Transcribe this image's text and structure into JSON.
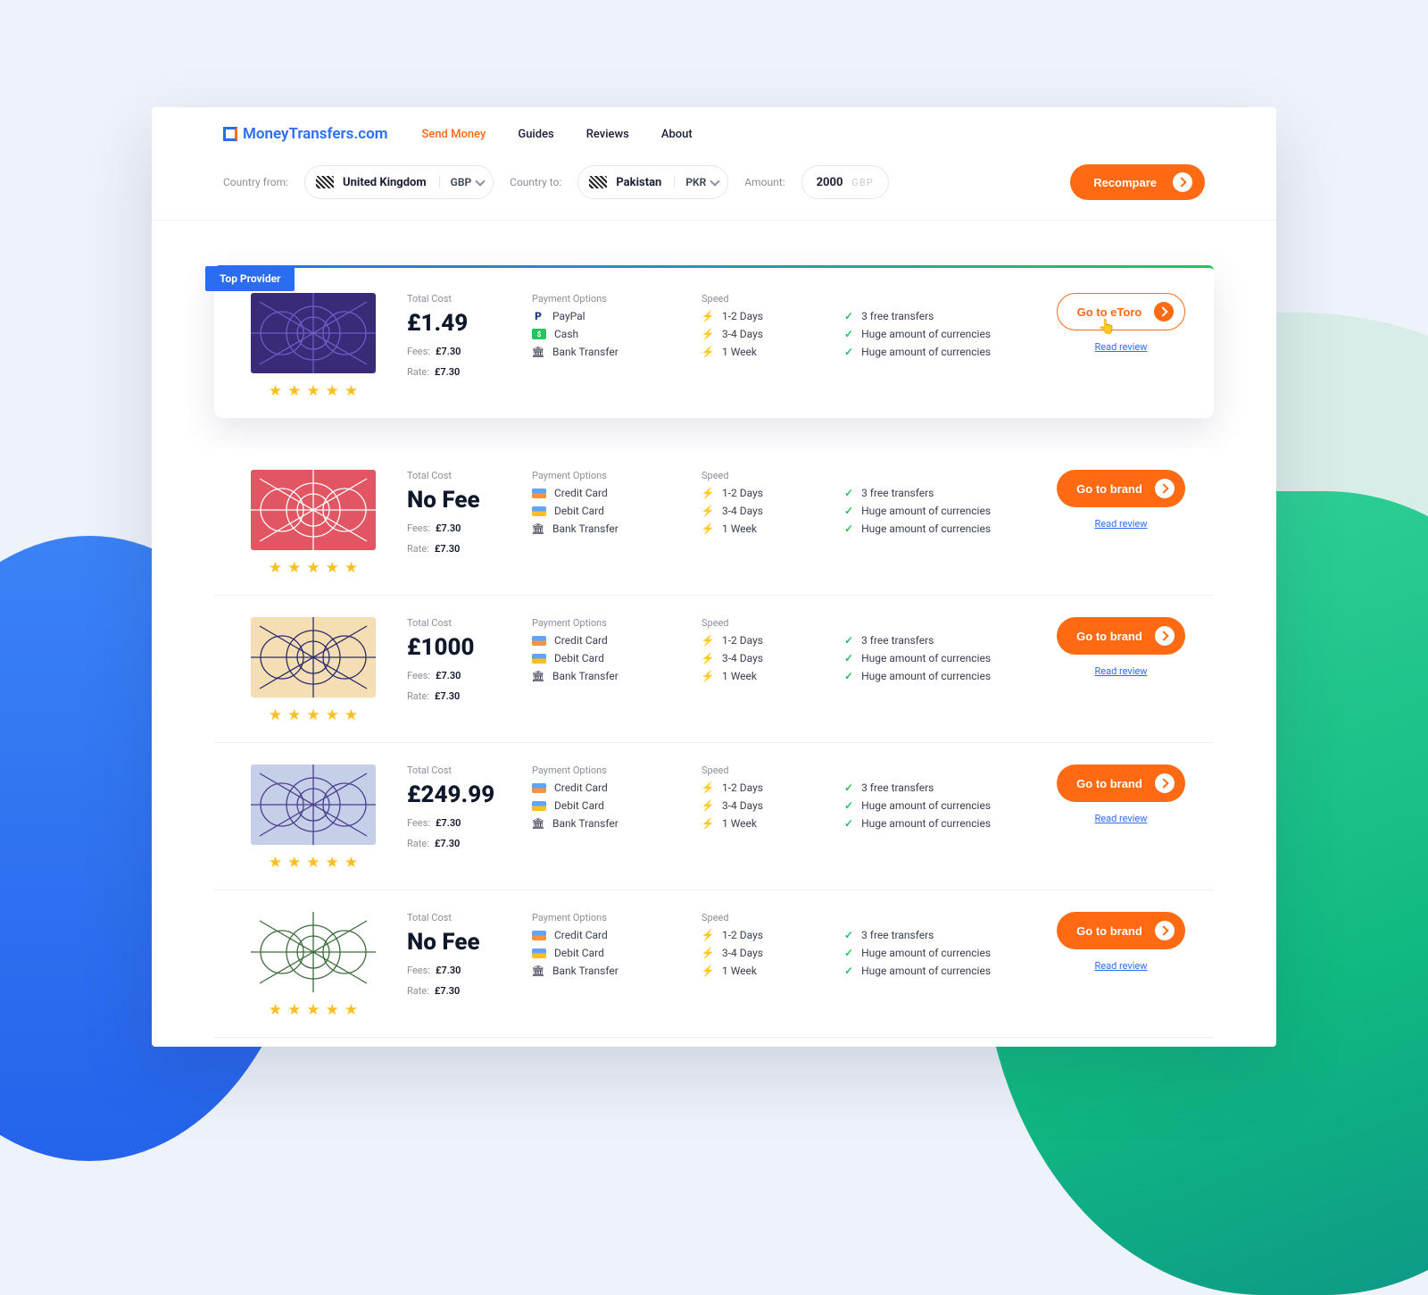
{
  "brand": "MoneyTransfers.com",
  "nav": {
    "items": [
      "Send Money",
      "Guides",
      "Reviews",
      "About"
    ],
    "active": "Send Money"
  },
  "filter": {
    "from_label": "Country from:",
    "from_country": "United Kingdom",
    "from_currency": "GBP",
    "to_label": "Country to:",
    "to_country": "Pakistan",
    "to_currency": "PKR",
    "amount_label": "Amount:",
    "amount_value": "2000",
    "amount_unit": "GBP",
    "button": "Recompare"
  },
  "labels": {
    "total_cost": "Total Cost",
    "payment_options": "Payment Options",
    "speed": "Speed",
    "fees": "Fees:",
    "rate": "Rate:",
    "read_review": "Read review",
    "top_badge": "Top Provider"
  },
  "speed_rows": [
    "1-2 Days",
    "3-4 Days",
    "1 Week"
  ],
  "benefit_rows": [
    "3 free transfers",
    "Huge amount of currencies",
    "Huge amount of currencies"
  ],
  "providers": [
    {
      "featured": true,
      "cost": "£1.49",
      "fees": "£7.30",
      "rate": "£7.30",
      "payments": [
        [
          "paypal",
          "PayPal"
        ],
        [
          "cash",
          "Cash"
        ],
        [
          "bank",
          "Bank Transfer"
        ]
      ],
      "cta": "Go to eToro",
      "thumb": {
        "bg": "#3b2a78",
        "lines": "#6d5ec7"
      }
    },
    {
      "featured": false,
      "cost": "No Fee",
      "fees": "£7.30",
      "rate": "£7.30",
      "payments": [
        [
          "cc",
          "Credit Card"
        ],
        [
          "dc",
          "Debit Card"
        ],
        [
          "bank",
          "Bank Transfer"
        ]
      ],
      "cta": "Go to brand",
      "thumb": {
        "bg": "#e25563",
        "lines": "#ffffff"
      }
    },
    {
      "featured": false,
      "cost": "£1000",
      "fees": "£7.30",
      "rate": "£7.30",
      "payments": [
        [
          "cc",
          "Credit Card"
        ],
        [
          "dc",
          "Debit Card"
        ],
        [
          "bank",
          "Bank Transfer"
        ]
      ],
      "cta": "Go to brand",
      "thumb": {
        "bg": "#f5deb3",
        "lines": "#2b2b6b"
      }
    },
    {
      "featured": false,
      "cost": "£249.99",
      "fees": "£7.30",
      "rate": "£7.30",
      "payments": [
        [
          "cc",
          "Credit Card"
        ],
        [
          "dc",
          "Debit Card"
        ],
        [
          "bank",
          "Bank Transfer"
        ]
      ],
      "cta": "Go to brand",
      "thumb": {
        "bg": "#c5cfe8",
        "lines": "#4a3f8f"
      }
    },
    {
      "featured": false,
      "cost": "No Fee",
      "fees": "£7.30",
      "rate": "£7.30",
      "payments": [
        [
          "cc",
          "Credit Card"
        ],
        [
          "dc",
          "Debit Card"
        ],
        [
          "bank",
          "Bank Transfer"
        ]
      ],
      "cta": "Go to brand",
      "thumb": {
        "bg": "#ffffff",
        "lines": "#3c6b3c"
      }
    }
  ]
}
